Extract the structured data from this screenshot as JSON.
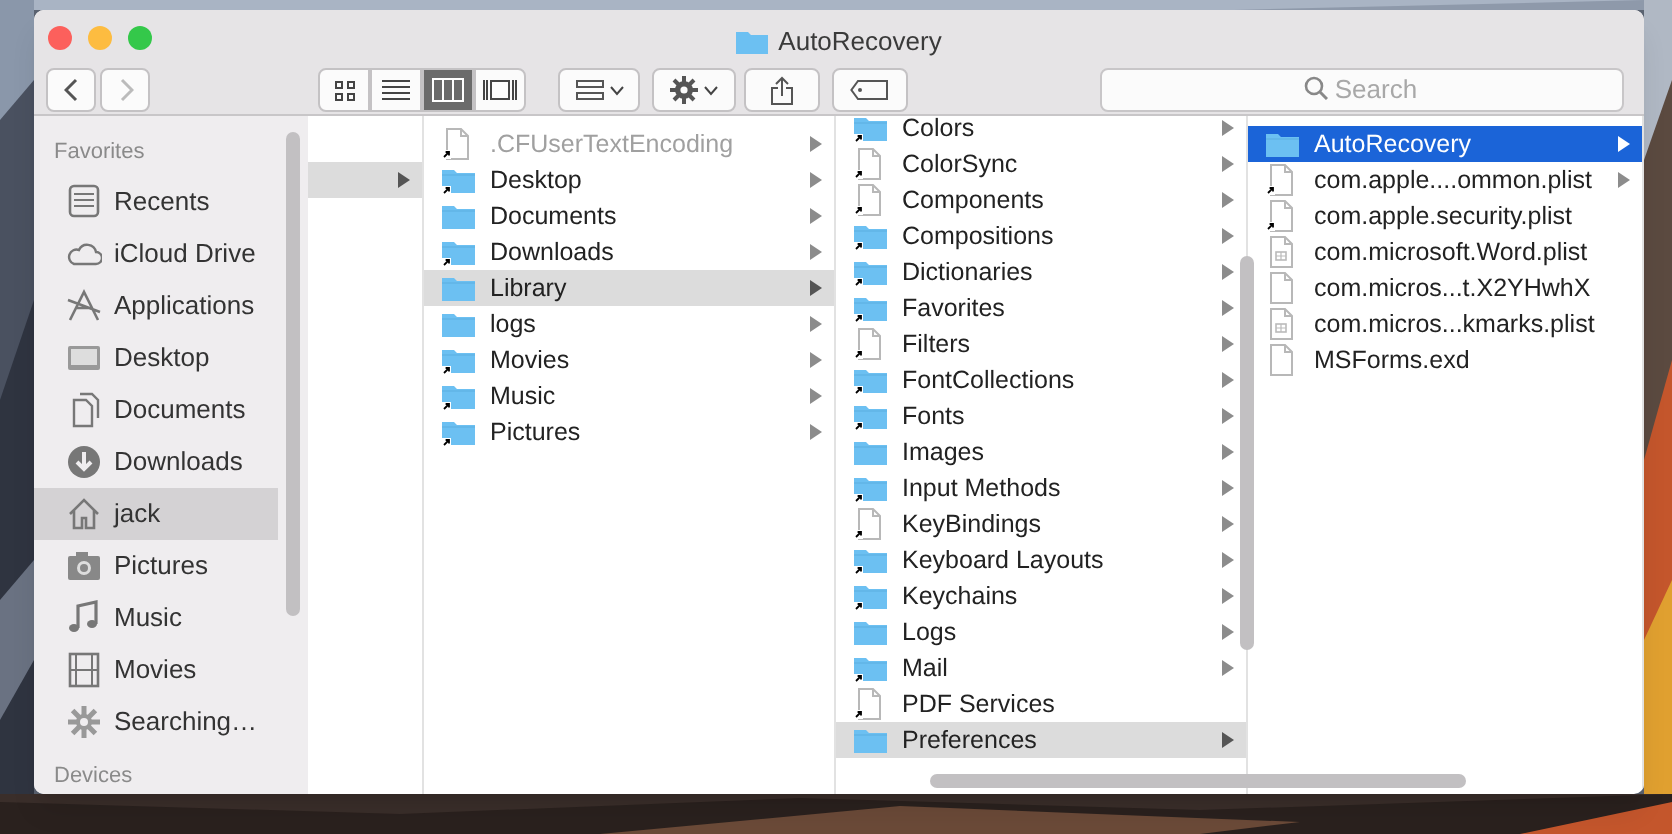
{
  "window": {
    "title": "AutoRecovery"
  },
  "toolbar": {
    "views": [
      {
        "selected": false
      },
      {
        "selected": false
      },
      {
        "selected": true
      },
      {
        "selected": false
      }
    ],
    "search": {
      "placeholder": "Search"
    }
  },
  "sidebar": {
    "sections": [
      {
        "heading": "Favorites",
        "items": [
          {
            "label": "Recents",
            "selected": false
          },
          {
            "label": "iCloud Drive",
            "selected": false
          },
          {
            "label": "Applications",
            "selected": false
          },
          {
            "label": "Desktop",
            "selected": false
          },
          {
            "label": "Documents",
            "selected": false
          },
          {
            "label": "Downloads",
            "selected": false
          },
          {
            "label": "jack",
            "selected": true
          },
          {
            "label": "Pictures",
            "selected": false
          },
          {
            "label": "Music",
            "selected": false
          },
          {
            "label": "Movies",
            "selected": false
          },
          {
            "label": "Searching…",
            "selected": false
          }
        ]
      },
      {
        "heading": "Devices"
      }
    ]
  },
  "columns": [
    {
      "active": false,
      "rows": [
        {
          "selected": true,
          "has_children": true
        }
      ]
    },
    {
      "active": false,
      "rows": [
        {
          "label": ".CFUserTextEncoding",
          "kind": "alias-file",
          "dimmed": true,
          "selected": false,
          "has_children": true
        },
        {
          "label": "Desktop",
          "kind": "alias-folder",
          "dimmed": false,
          "selected": false,
          "has_children": true
        },
        {
          "label": "Documents",
          "kind": "folder",
          "dimmed": false,
          "selected": false,
          "has_children": true
        },
        {
          "label": "Downloads",
          "kind": "alias-folder",
          "dimmed": false,
          "selected": false,
          "has_children": true
        },
        {
          "label": "Library",
          "kind": "folder",
          "dimmed": false,
          "selected": true,
          "has_children": true
        },
        {
          "label": "logs",
          "kind": "folder",
          "dimmed": false,
          "selected": false,
          "has_children": true
        },
        {
          "label": "Movies",
          "kind": "alias-folder",
          "dimmed": false,
          "selected": false,
          "has_children": true
        },
        {
          "label": "Music",
          "kind": "alias-folder",
          "dimmed": false,
          "selected": false,
          "has_children": true
        },
        {
          "label": "Pictures",
          "kind": "alias-folder",
          "dimmed": false,
          "selected": false,
          "has_children": true
        }
      ]
    },
    {
      "active": false,
      "rows": [
        {
          "label": "Colors",
          "kind": "alias-folder",
          "dimmed": false,
          "selected": false,
          "has_children": true
        },
        {
          "label": "ColorSync",
          "kind": "alias-file",
          "dimmed": false,
          "selected": false,
          "has_children": true
        },
        {
          "label": "Components",
          "kind": "alias-file",
          "dimmed": false,
          "selected": false,
          "has_children": true
        },
        {
          "label": "Compositions",
          "kind": "alias-folder",
          "dimmed": false,
          "selected": false,
          "has_children": true
        },
        {
          "label": "Dictionaries",
          "kind": "alias-folder",
          "dimmed": false,
          "selected": false,
          "has_children": true
        },
        {
          "label": "Favorites",
          "kind": "alias-folder",
          "dimmed": false,
          "selected": false,
          "has_children": true
        },
        {
          "label": "Filters",
          "kind": "alias-file",
          "dimmed": false,
          "selected": false,
          "has_children": true
        },
        {
          "label": "FontCollections",
          "kind": "alias-folder",
          "dimmed": false,
          "selected": false,
          "has_children": true
        },
        {
          "label": "Fonts",
          "kind": "alias-folder",
          "dimmed": false,
          "selected": false,
          "has_children": true
        },
        {
          "label": "Images",
          "kind": "folder",
          "dimmed": false,
          "selected": false,
          "has_children": true
        },
        {
          "label": "Input Methods",
          "kind": "alias-folder",
          "dimmed": false,
          "selected": false,
          "has_children": true
        },
        {
          "label": "KeyBindings",
          "kind": "alias-file",
          "dimmed": false,
          "selected": false,
          "has_children": true
        },
        {
          "label": "Keyboard Layouts",
          "kind": "alias-folder",
          "dimmed": false,
          "selected": false,
          "has_children": true
        },
        {
          "label": "Keychains",
          "kind": "alias-folder",
          "dimmed": false,
          "selected": false,
          "has_children": true
        },
        {
          "label": "Logs",
          "kind": "folder",
          "dimmed": false,
          "selected": false,
          "has_children": true
        },
        {
          "label": "Mail",
          "kind": "alias-folder",
          "dimmed": false,
          "selected": false,
          "has_children": true
        },
        {
          "label": "PDF Services",
          "kind": "alias-file",
          "dimmed": false,
          "selected": false,
          "has_children": false
        },
        {
          "label": "Preferences",
          "kind": "folder",
          "dimmed": false,
          "selected": true,
          "has_children": true
        }
      ]
    },
    {
      "active": true,
      "rows": [
        {
          "label": "AutoRecovery",
          "kind": "folder",
          "dimmed": false,
          "selected": true,
          "has_children": true
        },
        {
          "label": "com.apple....ommon.plist",
          "kind": "alias-file",
          "dimmed": false,
          "selected": false,
          "has_children": true
        },
        {
          "label": "com.apple.security.plist",
          "kind": "alias-file",
          "dimmed": false,
          "selected": false,
          "has_children": false
        },
        {
          "label": "com.microsoft.Word.plist",
          "kind": "plist",
          "dimmed": false,
          "selected": false,
          "has_children": false
        },
        {
          "label": "com.micros...t.X2YHwhX",
          "kind": "file",
          "dimmed": false,
          "selected": false,
          "has_children": false
        },
        {
          "label": "com.micros...kmarks.plist",
          "kind": "plist",
          "dimmed": false,
          "selected": false,
          "has_children": false
        },
        {
          "label": "MSForms.exd",
          "kind": "file",
          "dimmed": false,
          "selected": false,
          "has_children": false
        }
      ]
    }
  ]
}
